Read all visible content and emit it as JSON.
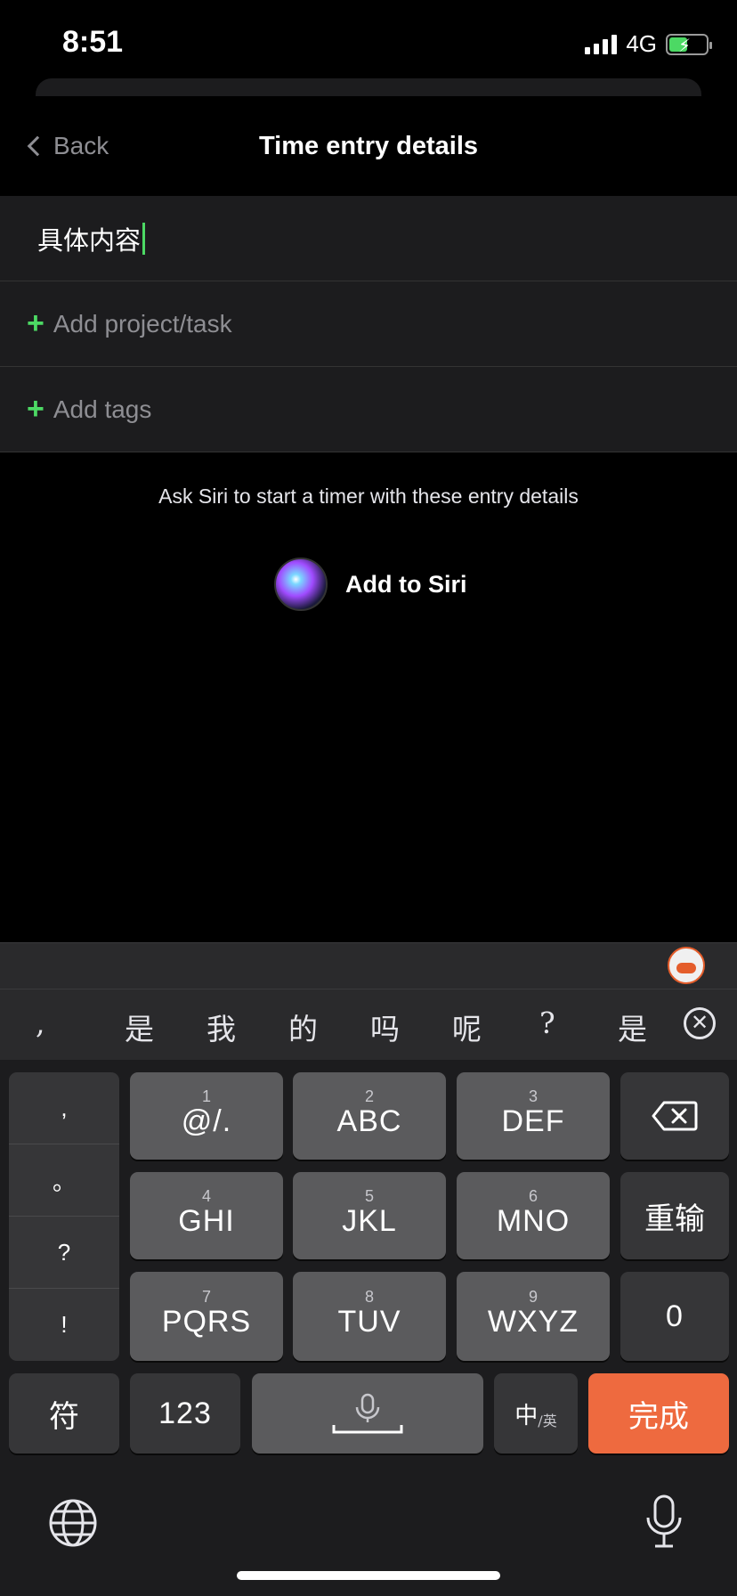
{
  "status_bar": {
    "time": "8:51",
    "network": "4G"
  },
  "nav": {
    "back_label": "Back",
    "title": "Time entry details"
  },
  "form": {
    "description_value": "具体内容",
    "add_project_label": "Add project/task",
    "add_tags_label": "Add tags"
  },
  "siri": {
    "hint": "Ask Siri to start a timer with these entry details",
    "button_label": "Add to Siri"
  },
  "candidates": [
    ",",
    "是",
    "我",
    "的",
    "吗",
    "呢",
    "?",
    "是"
  ],
  "keyboard": {
    "punct": [
      ",",
      "。",
      "?",
      "!"
    ],
    "rows": [
      [
        {
          "num": "1",
          "label": "@/."
        },
        {
          "num": "2",
          "label": "ABC"
        },
        {
          "num": "3",
          "label": "DEF"
        }
      ],
      [
        {
          "num": "4",
          "label": "GHI"
        },
        {
          "num": "5",
          "label": "JKL"
        },
        {
          "num": "6",
          "label": "MNO"
        }
      ],
      [
        {
          "num": "7",
          "label": "PQRS"
        },
        {
          "num": "8",
          "label": "TUV"
        },
        {
          "num": "9",
          "label": "WXYZ"
        }
      ]
    ],
    "reset_label": "重输",
    "zero_label": "0",
    "symbols_label": "符",
    "numbers_label": "123",
    "lang_main": "中",
    "lang_sub": "/英",
    "done_label": "完成"
  },
  "colors": {
    "accent_green": "#4cd964",
    "done_orange": "#ee6a3f"
  },
  "icons": [
    "back-chevron-icon",
    "plus-icon",
    "siri-icon",
    "close-icon",
    "backspace-icon",
    "mic-icon",
    "globe-icon"
  ]
}
